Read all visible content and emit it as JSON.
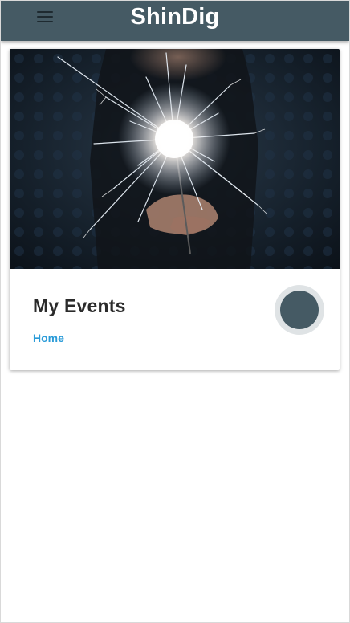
{
  "app": {
    "title": "ShinDig",
    "menu_icon": "hamburger-menu-icon",
    "bar_color": "#455a64"
  },
  "card": {
    "image": "sparkler-photo",
    "title": "My Events",
    "link_label": "Home",
    "link_color": "#2a9bd8",
    "fab_color": "#455a64"
  }
}
